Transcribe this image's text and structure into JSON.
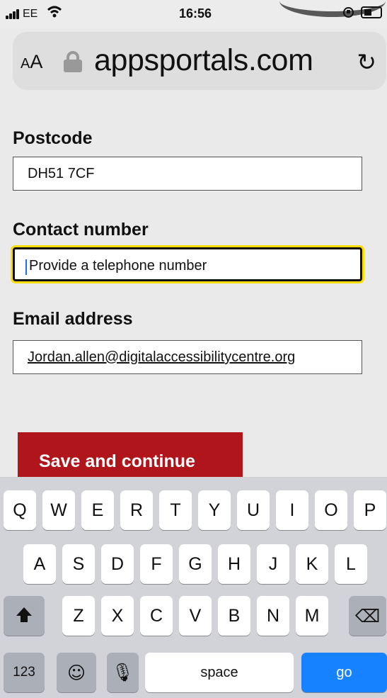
{
  "status_bar": {
    "carrier": "EE",
    "time": "16:56"
  },
  "browser": {
    "text_size_large": "A",
    "text_size_small": "A",
    "url": "appsportals.com"
  },
  "form": {
    "postcode": {
      "label": "Postcode",
      "value": "DH51 7CF"
    },
    "contact": {
      "label": "Contact number",
      "placeholder": "Provide a telephone number"
    },
    "email": {
      "label": "Email address",
      "value": "Jordan.allen@digitalaccessibilitycentre.org"
    },
    "save_button": "Save and continue"
  },
  "keyboard": {
    "row1": [
      "Q",
      "W",
      "E",
      "R",
      "T",
      "Y",
      "U",
      "I",
      "O",
      "P"
    ],
    "row2": [
      "A",
      "S",
      "D",
      "F",
      "G",
      "H",
      "J",
      "K",
      "L"
    ],
    "row3": [
      "Z",
      "X",
      "C",
      "V",
      "B",
      "N",
      "M"
    ],
    "numbers_key": "123",
    "space_key": "space",
    "go_key": "go"
  },
  "icons": {
    "signal": "signal-bars-icon",
    "wifi": "wifi-icon",
    "rotation_lock": "rotation-lock-icon",
    "battery": "battery-icon",
    "lock": "padlock-icon",
    "reload": "reload-icon",
    "shift": "shift-icon",
    "delete": "delete-icon",
    "emoji": "emoji-icon",
    "microphone": "microphone-icon"
  },
  "colors": {
    "save_button": "#b0151b",
    "go_key": "#1682ff",
    "focus_ring": "#ffdd00"
  }
}
